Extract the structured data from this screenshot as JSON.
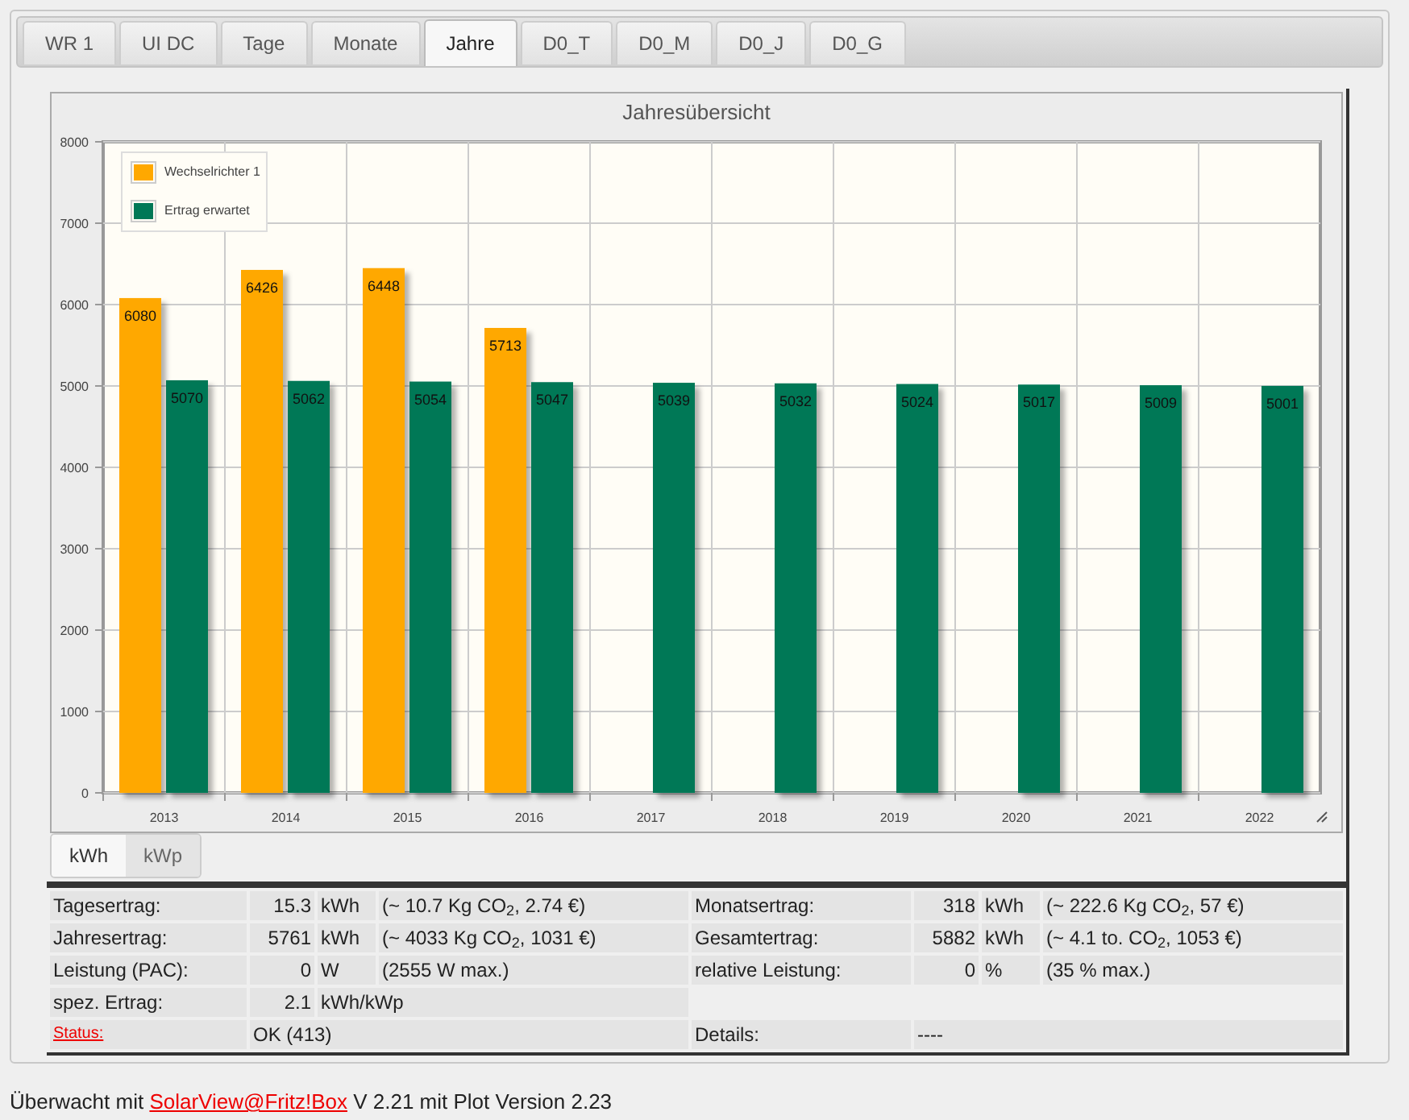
{
  "tabs": [
    {
      "label": "WR 1",
      "selected": false
    },
    {
      "label": "UI DC",
      "selected": false
    },
    {
      "label": "Tage",
      "selected": false
    },
    {
      "label": "Monate",
      "selected": false
    },
    {
      "label": "Jahre",
      "selected": true
    },
    {
      "label": "D0_T",
      "selected": false
    },
    {
      "label": "D0_M",
      "selected": false
    },
    {
      "label": "D0_J",
      "selected": false
    },
    {
      "label": "D0_G",
      "selected": false
    }
  ],
  "chart": {
    "chart_data": {
      "type": "bar",
      "title": "Jahresübersicht",
      "categories": [
        "2013",
        "2014",
        "2015",
        "2016",
        "2017",
        "2018",
        "2019",
        "2020",
        "2021",
        "2022"
      ],
      "series": [
        {
          "name": "Wechselrichter 1",
          "color": "#ffa800",
          "values": [
            6080,
            6426,
            6448,
            5713,
            null,
            null,
            null,
            null,
            null,
            null
          ]
        },
        {
          "name": "Ertrag erwartet",
          "color": "#007856",
          "values": [
            5070,
            5062,
            5054,
            5047,
            5039,
            5032,
            5024,
            5017,
            5009,
            5001
          ]
        }
      ],
      "ylim": [
        0,
        8000
      ],
      "yticks": [
        0,
        1000,
        2000,
        3000,
        4000,
        5000,
        6000,
        7000,
        8000
      ],
      "data_labels": true,
      "grid": true,
      "legend": true
    }
  },
  "units": [
    {
      "label": "kWh",
      "selected": true
    },
    {
      "label": "kWp",
      "selected": false
    }
  ],
  "stats": [
    {
      "left": {
        "label": "Tagesertrag:",
        "value": "15.3",
        "unit": "kWh",
        "note": "(~ 10.7 Kg CO$_{2}$, 2.74 €)"
      },
      "right": {
        "label": "Monatsertrag:",
        "value": "318",
        "unit": "kWh",
        "note": "(~ 222.6 Kg CO$_{2}$, 57 €)"
      }
    },
    {
      "left": {
        "label": "Jahresertrag:",
        "value": "5761",
        "unit": "kWh",
        "note": "(~ 4033 Kg CO$_{2}$, 1031 €)"
      },
      "right": {
        "label": "Gesamtertrag:",
        "value": "5882",
        "unit": "kWh",
        "note": "(~ 4.1 to. CO$_{2}$, 1053 €)"
      }
    },
    {
      "left": {
        "label": "Leistung (PAC):",
        "value": "0",
        "unit": "W",
        "note": "(2555 W max.)"
      },
      "right": {
        "label": "relative Leistung:",
        "value": "0",
        "unit": "%",
        "note": "(35 % max.)"
      }
    },
    {
      "left": {
        "label": "spez. Ertrag:",
        "value": "2.1",
        "unit": "kWh/kWp"
      }
    },
    {
      "left": {
        "label": "Status:",
        "kind": "link",
        "value": "OK (413)"
      },
      "right": {
        "label": "Details:",
        "value": "----"
      }
    }
  ],
  "footer": {
    "before": "Überwacht mit",
    "link": "SolarView@Fritz!Box",
    "after": "V 2.21 mit Plot Version 2.23"
  }
}
